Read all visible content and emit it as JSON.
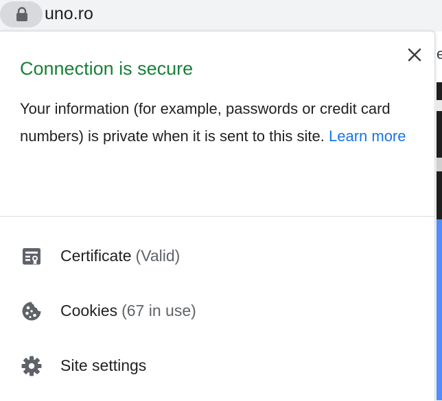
{
  "address_bar": {
    "url": "uno.ro",
    "lock_icon": "lock-icon"
  },
  "background_page": {
    "visible_letter": "e"
  },
  "popup": {
    "close_icon": "close-icon",
    "title": "Connection is secure",
    "title_color": "#188038",
    "description": "Your information (for example, passwords or credit card numbers) is private when it is sent to this site.",
    "learn_more_label": "Learn more",
    "link_color": "#1a73e8",
    "items": [
      {
        "icon": "certificate-icon",
        "label": "Certificate",
        "detail": "(Valid)"
      },
      {
        "icon": "cookie-icon",
        "label": "Cookies",
        "detail": "(67 in use)"
      },
      {
        "icon": "gear-icon",
        "label": "Site settings",
        "detail": ""
      }
    ]
  }
}
